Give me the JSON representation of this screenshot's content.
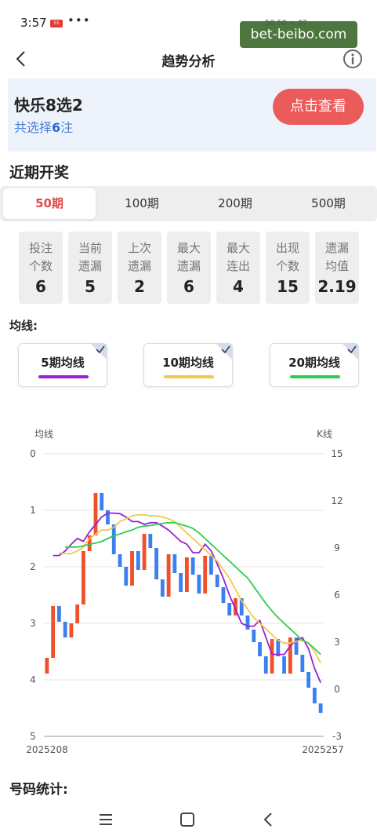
{
  "status_bar": {
    "time": "3:57",
    "badge": "55",
    "dots": "•••",
    "icons_text": "5G 5G ᯤ 97"
  },
  "watermark": "bet-beibo.com",
  "header": {
    "title": "趋势分析",
    "back_icon": "back-chevron-icon",
    "info_icon": "info-icon"
  },
  "lottery": {
    "name": "快乐8选2",
    "selection_prefix": "共选择",
    "selection_count": "6",
    "selection_suffix": "注",
    "view_button": "点击查看",
    "accent_color": "#ec5b5b"
  },
  "recent": {
    "title": "近期开奖",
    "tabs": [
      {
        "label": "50期",
        "active": true
      },
      {
        "label": "100期",
        "active": false
      },
      {
        "label": "200期",
        "active": false
      },
      {
        "label": "500期",
        "active": false
      }
    ],
    "stats": [
      {
        "label": "投注个数",
        "value": "6"
      },
      {
        "label": "当前遗漏",
        "value": "5"
      },
      {
        "label": "上次遗漏",
        "value": "2"
      },
      {
        "label": "最大遗漏",
        "value": "6"
      },
      {
        "label": "最大连出",
        "value": "4"
      },
      {
        "label": "出现个数",
        "value": "15"
      },
      {
        "label": "遗漏均值",
        "value": "2.19"
      }
    ]
  },
  "moving_average": {
    "label": "均线:",
    "buttons": [
      {
        "label": "5期均线",
        "color": "#9b1fd8",
        "checked": true
      },
      {
        "label": "10期均线",
        "color": "#f2c94c",
        "checked": true
      },
      {
        "label": "20期均线",
        "color": "#2ecc4f",
        "checked": true
      }
    ]
  },
  "chart_data": {
    "type": "candlestick-line",
    "left_axis_label": "均线",
    "right_axis_label": "K线",
    "left_ticks": [
      "0",
      "1",
      "2",
      "3",
      "4",
      "5"
    ],
    "right_ticks": [
      "15",
      "12",
      "9",
      "6",
      "3",
      "0",
      "-3"
    ],
    "left_range": [
      0,
      5
    ],
    "right_range": [
      -3,
      15
    ],
    "x_start_label": "2025208",
    "x_end_label": "2025257",
    "up_color": "#f0502a",
    "down_color": "#3a80f0",
    "candles": [
      {
        "o": 1,
        "c": 2
      },
      {
        "o": 2,
        "c": 5.3
      },
      {
        "o": 5.3,
        "c": 4.3
      },
      {
        "o": 4.3,
        "c": 3.3
      },
      {
        "o": 3.3,
        "c": 4.2
      },
      {
        "o": 4.2,
        "c": 5.4
      },
      {
        "o": 5.4,
        "c": 8.8
      },
      {
        "o": 8.8,
        "c": 9.8
      },
      {
        "o": 9.8,
        "c": 12.5
      },
      {
        "o": 12.5,
        "c": 11.4
      },
      {
        "o": 11.4,
        "c": 10.5
      },
      {
        "o": 10.5,
        "c": 8.6
      },
      {
        "o": 8.6,
        "c": 7.8
      },
      {
        "o": 7.8,
        "c": 6.6
      },
      {
        "o": 6.6,
        "c": 8.8
      },
      {
        "o": 8.8,
        "c": 7.6
      },
      {
        "o": 7.6,
        "c": 9.9
      },
      {
        "o": 9.9,
        "c": 9.0
      },
      {
        "o": 9.0,
        "c": 7.0
      },
      {
        "o": 7.0,
        "c": 5.9
      },
      {
        "o": 5.9,
        "c": 8.6
      },
      {
        "o": 8.6,
        "c": 7.4
      },
      {
        "o": 7.4,
        "c": 6.2
      },
      {
        "o": 6.2,
        "c": 8.4
      },
      {
        "o": 8.4,
        "c": 7.3
      },
      {
        "o": 7.3,
        "c": 6.1
      },
      {
        "o": 6.1,
        "c": 8.5
      },
      {
        "o": 8.5,
        "c": 7.3
      },
      {
        "o": 7.3,
        "c": 6.5
      },
      {
        "o": 6.5,
        "c": 5.5
      },
      {
        "o": 5.5,
        "c": 4.7
      },
      {
        "o": 4.7,
        "c": 5.8
      },
      {
        "o": 5.8,
        "c": 4.7
      },
      {
        "o": 4.7,
        "c": 3.8
      },
      {
        "o": 3.8,
        "c": 3.0
      },
      {
        "o": 3.0,
        "c": 2.1
      },
      {
        "o": 2.1,
        "c": 1.0
      },
      {
        "o": 1.0,
        "c": 3.2
      },
      {
        "o": 3.2,
        "c": 2.1
      },
      {
        "o": 2.1,
        "c": 1.0
      },
      {
        "o": 1.0,
        "c": 3.3
      },
      {
        "o": 3.3,
        "c": 2.2
      },
      {
        "o": 2.2,
        "c": 1.1
      },
      {
        "o": 1.1,
        "c": 0.1
      },
      {
        "o": 0.1,
        "c": -0.9
      },
      {
        "o": -0.9,
        "c": -1.5
      }
    ],
    "series": [
      {
        "name": "5期均线",
        "color": "#9b1fd8",
        "values": [
          1.8,
          1.8,
          1.72,
          1.6,
          1.5,
          1.55,
          1.38,
          1.25,
          1.12,
          1.05,
          1.05,
          1.06,
          1.12,
          1.2,
          1.2,
          1.25,
          1.22,
          1.22,
          1.28,
          1.35,
          1.45,
          1.55,
          1.6,
          1.75,
          1.75,
          1.6,
          1.72,
          1.95,
          2.2,
          2.5,
          2.75,
          3.0,
          3.05,
          3.05,
          2.95,
          3.25,
          3.55,
          3.55,
          3.55,
          3.4,
          3.3,
          3.25,
          3.45,
          3.8,
          4.05
        ]
      },
      {
        "name": "10期均线",
        "color": "#f2c94c",
        "values": [
          1.75,
          1.77,
          1.77,
          1.72,
          1.65,
          1.5,
          1.42,
          1.35,
          1.35,
          1.3,
          1.2,
          1.15,
          1.1,
          1.08,
          1.08,
          1.1,
          1.1,
          1.12,
          1.15,
          1.2,
          1.3,
          1.4,
          1.5,
          1.6,
          1.7,
          1.8,
          1.9,
          2.05,
          2.2,
          2.4,
          2.6,
          2.75,
          2.9,
          3.0,
          3.1,
          3.2,
          3.3,
          3.35,
          3.35,
          3.32,
          3.3,
          3.35,
          3.5,
          3.7
        ]
      },
      {
        "name": "20期均线",
        "color": "#2ecc4f",
        "values": [
          1.65,
          1.65,
          1.65,
          1.63,
          1.6,
          1.58,
          1.55,
          1.5,
          1.45,
          1.42,
          1.38,
          1.35,
          1.3,
          1.28,
          1.27,
          1.25,
          1.23,
          1.22,
          1.22,
          1.25,
          1.28,
          1.32,
          1.4,
          1.5,
          1.6,
          1.7,
          1.8,
          1.9,
          2.0,
          2.1,
          2.2,
          2.35,
          2.5,
          2.65,
          2.78,
          2.9,
          3.0,
          3.1,
          3.2,
          3.3,
          3.35,
          3.45,
          3.55
        ]
      }
    ]
  },
  "number_stats": {
    "title": "号码统计:"
  },
  "bottom_nav": [
    "menu-icon",
    "home-icon",
    "back-icon"
  ]
}
